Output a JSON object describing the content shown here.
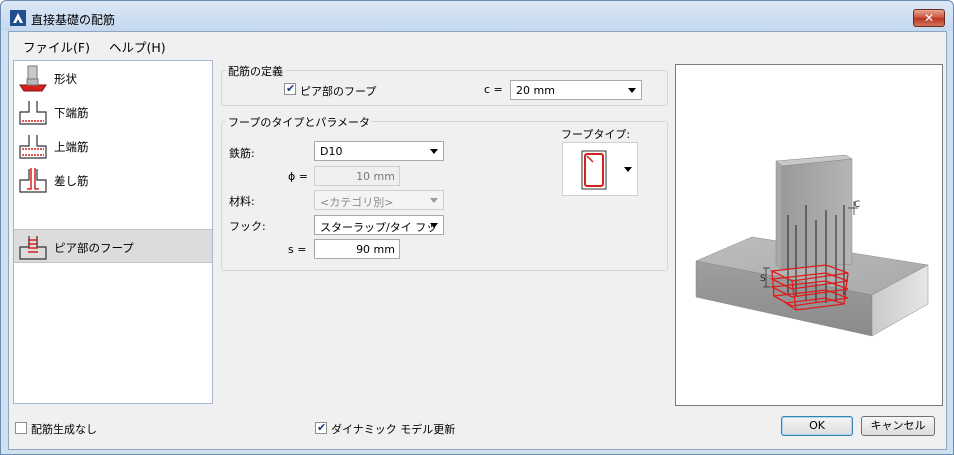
{
  "window": {
    "title": "直接基礎の配筋"
  },
  "menu": [
    {
      "label": "ファイル(F)"
    },
    {
      "label": "ヘルプ(H)"
    }
  ],
  "nav": {
    "items": [
      {
        "label": "形状",
        "icon": "footing-shape-icon"
      },
      {
        "label": "下端筋",
        "icon": "bottom-rebar-icon"
      },
      {
        "label": "上端筋",
        "icon": "top-rebar-icon"
      },
      {
        "label": "差し筋",
        "icon": "dowel-rebar-icon"
      },
      {
        "label": "ピア部のフープ",
        "icon": "pier-hoop-icon"
      }
    ],
    "selected_index": 4
  },
  "definition": {
    "title": "配筋の定義",
    "pier_hoop_checkbox": {
      "label": "ピア部のフープ",
      "checked": true
    },
    "c_label": "c =",
    "c_value": "20 mm"
  },
  "hoop_params": {
    "title": "フープのタイプとパラメータ",
    "rebar_label": "鉄筋:",
    "rebar_value": "D10",
    "phi_label": "ϕ =",
    "phi_value": "10 mm",
    "material_label": "材料:",
    "material_value": "<カテゴリ別>",
    "hook_label": "フック:",
    "hook_value": "スターラップ/タイ フッ",
    "s_label": "s =",
    "s_value": "90 mm",
    "hoop_type_label": "フープタイプ:"
  },
  "preview": {
    "c_annotation": "C",
    "s_annotation": "S"
  },
  "footer": {
    "no_rebar_checkbox": {
      "label": "配筋生成なし",
      "checked": false
    },
    "dynamic_update_checkbox": {
      "label": "ダイナミック モデル更新",
      "checked": true
    },
    "ok_label": "OK",
    "cancel_label": "キャンセル"
  },
  "colors": {
    "accent_red": "#e01b1b",
    "selection_gray": "#dcdcdc",
    "title_bar": "#c4d8ee"
  }
}
